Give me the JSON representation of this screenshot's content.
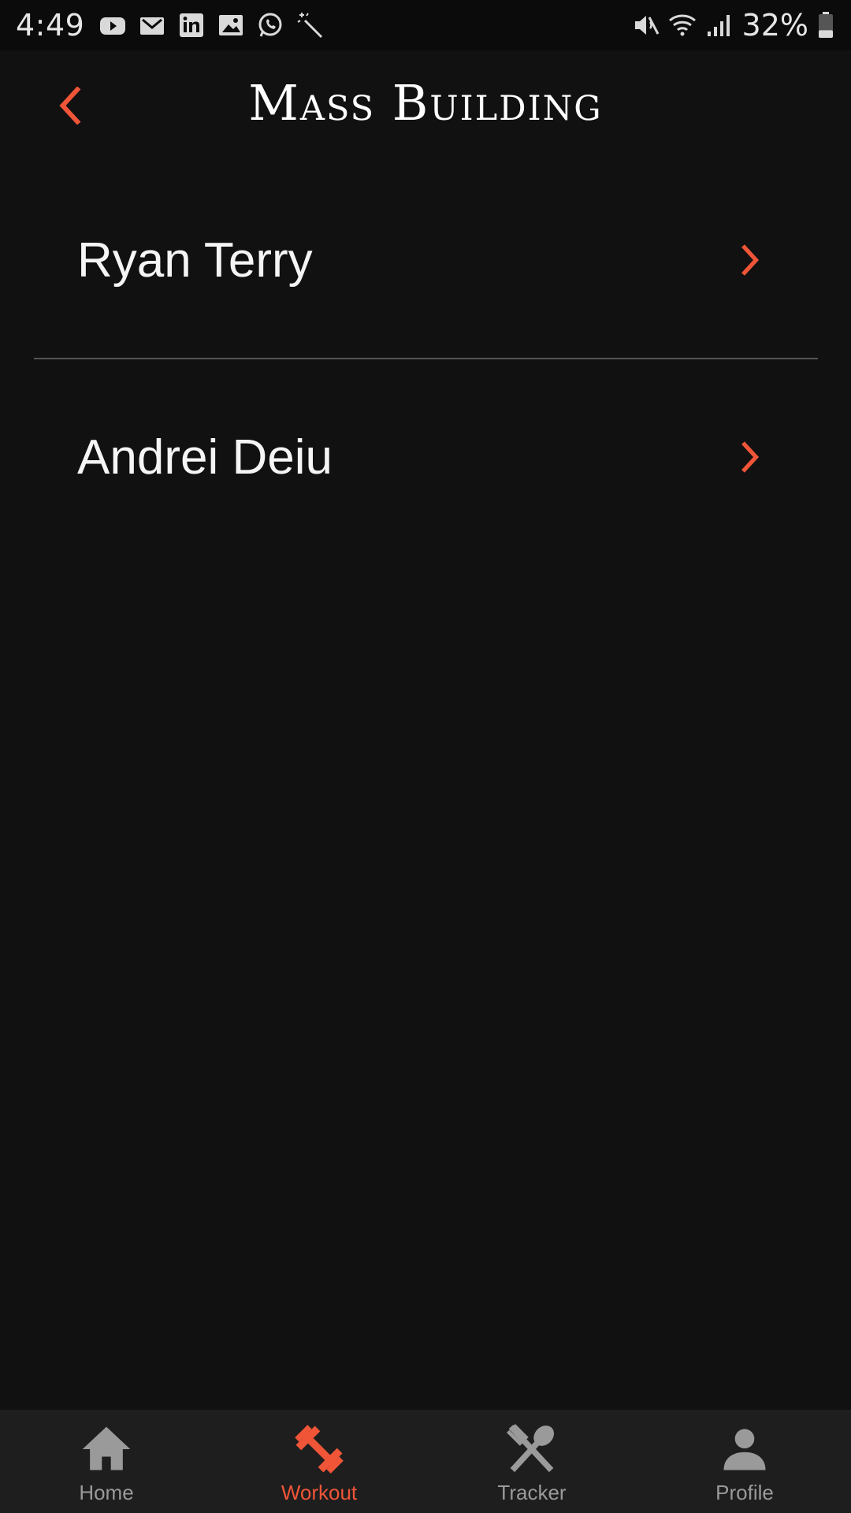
{
  "status_bar": {
    "time": "4:49",
    "left_icons": [
      "youtube-icon",
      "gmail-icon",
      "linkedin-icon",
      "gallery-icon",
      "whatsapp-icon",
      "magic-wand-icon"
    ],
    "right_icons": [
      "mute-icon",
      "wifi-icon",
      "signal-icon"
    ],
    "battery_percent": "32%",
    "battery_level": 0.32
  },
  "header": {
    "title": "Mass Building",
    "back_icon": "chevron-left-icon"
  },
  "list": {
    "items": [
      {
        "label": "Ryan Terry"
      },
      {
        "label": "Andrei Deiu"
      }
    ]
  },
  "bottom_nav": {
    "items": [
      {
        "label": "Home",
        "icon": "home-icon",
        "active": false
      },
      {
        "label": "Workout",
        "icon": "dumbbell-icon",
        "active": true
      },
      {
        "label": "Tracker",
        "icon": "utensils-icon",
        "active": false
      },
      {
        "label": "Profile",
        "icon": "person-icon",
        "active": false
      }
    ]
  },
  "colors": {
    "accent": "#f05538",
    "background": "#111111",
    "nav_background": "#1e1e1e",
    "inactive": "#9a9a9a"
  }
}
